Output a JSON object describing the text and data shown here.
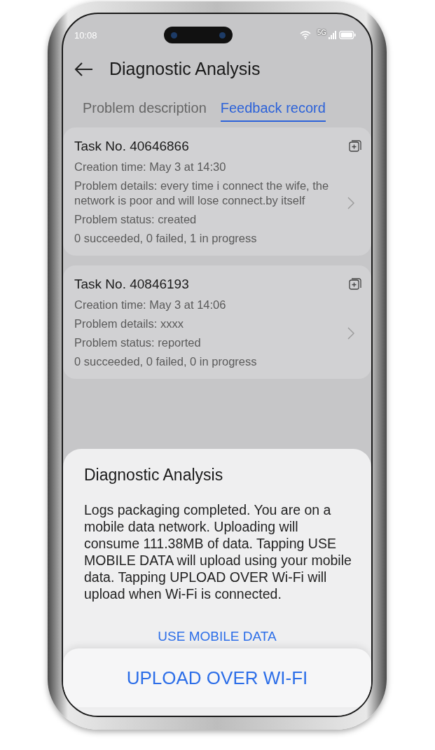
{
  "status_bar": {
    "time": "10:08",
    "network": "5G"
  },
  "header": {
    "title": "Diagnostic Analysis"
  },
  "tabs": [
    {
      "label": "Problem description",
      "selected": false
    },
    {
      "label": "Feedback record",
      "selected": true
    }
  ],
  "tasks": [
    {
      "title": "Task No. 40646866",
      "lines": [
        "Creation time: May 3 at 14:30",
        "Problem details: every time i connect the wife, the network is poor and will lose connect.by itself",
        "Problem status: created",
        "0 succeeded, 0 failed, 1 in progress"
      ]
    },
    {
      "title": "Task No. 40846193",
      "lines": [
        "Creation time: May 3 at 14:06",
        "Problem details: xxxx",
        "Problem status: reported",
        "0 succeeded, 0 failed, 0 in progress"
      ]
    }
  ],
  "dialog": {
    "title": "Diagnostic Analysis",
    "message": "Logs packaging completed. You are on a mobile data network. Uploading will consume 111.38MB of data. Tapping USE MOBILE DATA will upload using your mobile data. Tapping UPLOAD OVER Wi-Fi will upload when Wi-Fi is connected.",
    "buttons": [
      {
        "label": "USE MOBILE DATA",
        "kind": "text"
      },
      {
        "label": "UPLOAD OVER WI-FI",
        "kind": "card"
      }
    ]
  }
}
